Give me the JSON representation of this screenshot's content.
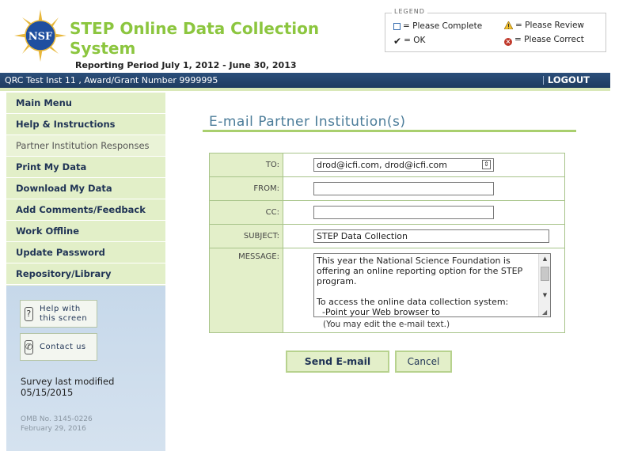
{
  "header": {
    "app_title": "STEP Online Data Collection System",
    "reporting_period": "Reporting Period July 1, 2012 - June 30, 2013",
    "logo_text": "NSF"
  },
  "legend": {
    "title": "LEGEND",
    "items": [
      {
        "icon": "empty-checkbox-icon",
        "label": "= Please Complete"
      },
      {
        "icon": "warning-triangle-icon",
        "label": "= Please Review"
      },
      {
        "icon": "checkmark-icon",
        "label": "= OK"
      },
      {
        "icon": "red-x-icon",
        "label": "= Please Correct"
      }
    ]
  },
  "topbar": {
    "institution": "QRC Test Inst 11 , Award/Grant Number 9999995",
    "logout": "LOGOUT"
  },
  "sidebar": {
    "items": [
      {
        "label": "Main Menu",
        "active": true
      },
      {
        "label": "Help & Instructions",
        "active": true
      },
      {
        "label": "Partner Institution Responses",
        "active": false
      },
      {
        "label": "Print My Data",
        "active": true
      },
      {
        "label": "Download My Data",
        "active": true
      },
      {
        "label": "Add Comments/Feedback",
        "active": true
      },
      {
        "label": "Work Offline",
        "active": true
      },
      {
        "label": "Update Password",
        "active": true
      },
      {
        "label": "Repository/Library",
        "active": true
      }
    ],
    "help_button": "Help with this screen",
    "help_line1": "Help with",
    "help_line2": "this screen",
    "contact_button": "Contact us",
    "survey_modified": "Survey last modified 05/15/2015",
    "omb_line1": "OMB No. 3145-0226",
    "omb_line2": "February 29, 2016"
  },
  "page": {
    "title": "E-mail Partner Institution(s)"
  },
  "form": {
    "to_label": "TO:",
    "to_value": "drod@icfi.com, drod@icfi.com",
    "from_label": "FROM:",
    "from_value": "",
    "cc_label": "CC:",
    "cc_value": "",
    "subject_label": "SUBJECT:",
    "subject_value": "STEP Data Collection",
    "message_label": "MESSAGE:",
    "message_lines": [
      "This year the National Science Foundation is",
      "offering an online reporting option for the STEP",
      "program.",
      "",
      "To access the online data collection system:",
      "  -Point your Web browser to"
    ],
    "edit_note": "(You may edit the e-mail text.)"
  },
  "buttons": {
    "send": "Send E-mail",
    "cancel": "Cancel"
  }
}
